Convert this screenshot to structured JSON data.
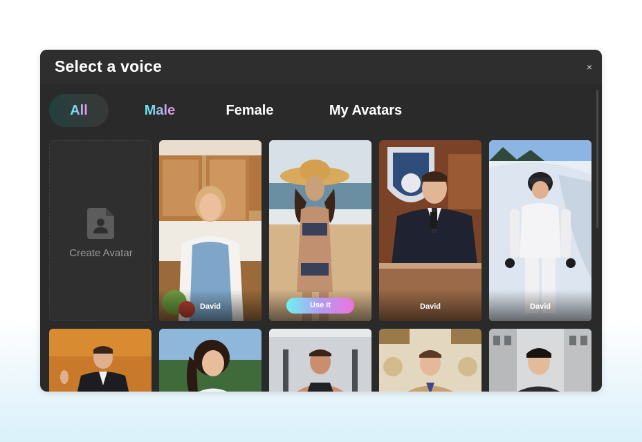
{
  "dialog": {
    "title": "Select a voice",
    "close_icon": "close-icon",
    "close_glyph": "×"
  },
  "tabs": [
    {
      "label": "All",
      "active": true
    },
    {
      "label": "Male",
      "active": false
    },
    {
      "label": "Female",
      "active": false
    },
    {
      "label": "My Avatars",
      "active": false
    }
  ],
  "create_card": {
    "label": "Create Avatar",
    "icon": "user-file-icon"
  },
  "avatars_row1": [
    {
      "name": "David",
      "subject": "woman in kitchen with apron"
    },
    {
      "name": "",
      "subject": "woman on beach with straw hat",
      "hover_button": "Use it"
    },
    {
      "name": "David",
      "subject": "news anchor at desk with microphone"
    },
    {
      "name": "David",
      "subject": "woman skiing in snow"
    }
  ],
  "avatars_row2": [
    {
      "subject": "man in suit on stage"
    },
    {
      "subject": "girl with ponytail outdoors"
    },
    {
      "subject": "man in gym"
    },
    {
      "subject": "young man in ornate room"
    },
    {
      "subject": "young man on street"
    }
  ],
  "colors": {
    "dialog_bg": "#2a2a2a",
    "accent_gradient_start": "#58f0f0",
    "accent_gradient_end": "#f48ce8"
  }
}
